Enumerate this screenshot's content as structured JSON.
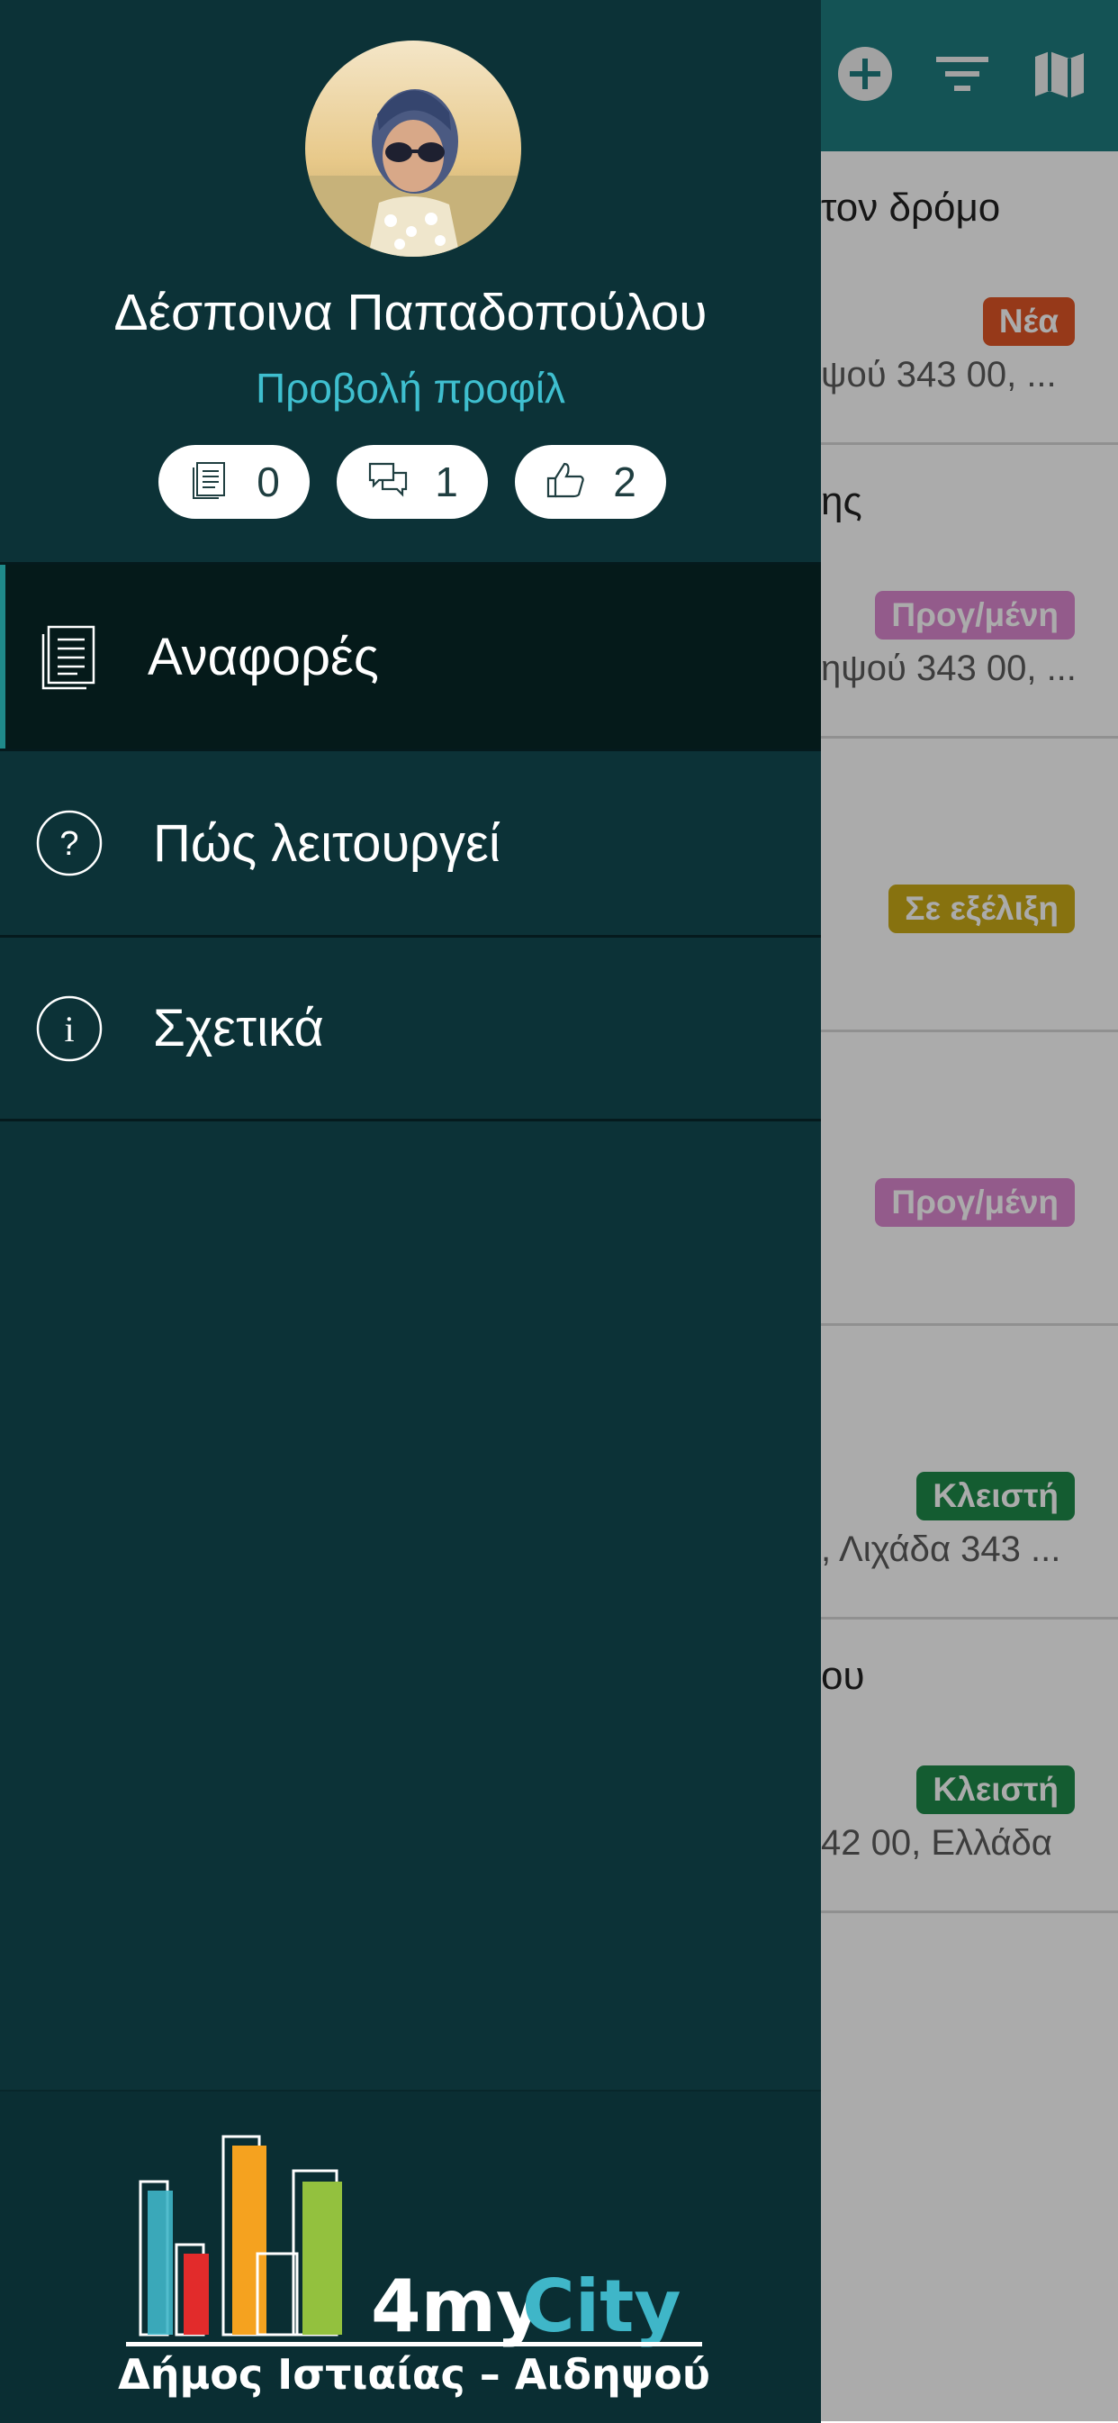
{
  "header": {
    "icons": [
      "plus-circle-icon",
      "filter-icon",
      "map-icon"
    ],
    "color": "#1e7d7f"
  },
  "reports": [
    {
      "title": "τον δρόμο",
      "badge": "Νέα",
      "badge_color": "#e05526",
      "address": "ψού 343 00, ..."
    },
    {
      "title": "ης",
      "badge": "Προγ/μένη",
      "badge_color": "#dc88d0",
      "address": "ηψού 343 00, ..."
    },
    {
      "title": "",
      "badge": "Σε εξέλιξη",
      "badge_color": "#c9aa17",
      "address": ""
    },
    {
      "title": "",
      "badge": "Προγ/μένη",
      "badge_color": "#dc88d0",
      "address": ""
    },
    {
      "title": "",
      "badge": "Κλειστή",
      "badge_color": "#1e8a4a",
      "address": ", Λιχάδα 343 ..."
    },
    {
      "title": "ου",
      "badge": "Κλειστή",
      "badge_color": "#1e8a4a",
      "address": "42 00, Ελλάδα"
    }
  ],
  "drawer": {
    "user_name": "Δέσποινα Παπαδοπούλου",
    "profile_link": "Προβολή προφίλ",
    "stats": [
      {
        "icon": "reports-icon",
        "value": "0"
      },
      {
        "icon": "comments-icon",
        "value": "1"
      },
      {
        "icon": "thumbs-up-icon",
        "value": "2"
      }
    ],
    "menu": [
      {
        "label": "Αναφορές",
        "icon": "document-icon",
        "active": true
      },
      {
        "label": "Πώς λειτουργεί",
        "icon": "question-icon",
        "active": false
      },
      {
        "label": "Σχετικά",
        "icon": "info-icon",
        "active": false
      }
    ],
    "logo": {
      "brand_prefix": "4my",
      "brand_suffix": "City",
      "subtitle": "Δήμος Ιστιαίας – Αιδηψού"
    }
  }
}
